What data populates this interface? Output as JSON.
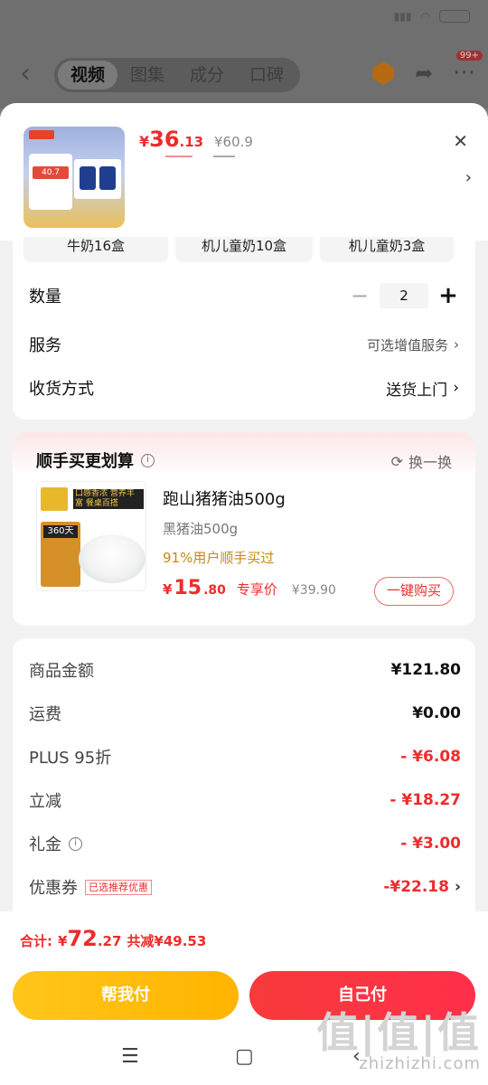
{
  "background": {
    "tabs": [
      "视频",
      "图集",
      "成分",
      "口碑"
    ],
    "active_tab": "视频",
    "cart_badge": "99+"
  },
  "product": {
    "price_symbol": "¥",
    "price_int": "36",
    "price_dec": ".13",
    "original_price": "¥60.9",
    "thumb_price_tag": "40.7"
  },
  "variants": [
    "牛奶16盒",
    "机儿童奶10盒",
    "机儿童奶3盒"
  ],
  "options": {
    "quantity_label": "数量",
    "quantity_value": "2",
    "service_label": "服务",
    "service_value": "可选增值服务",
    "delivery_label": "收货方式",
    "delivery_value": "送货上门"
  },
  "addon": {
    "title": "顺手买更划算",
    "refresh_label": "换一换",
    "name": "跑山猪猪油500g",
    "spec": "黑猪油500g",
    "stat": "91%用户顺手买过",
    "price_symbol": "¥",
    "price_int": "15",
    "price_dec": ".80",
    "price_tag": "专享价",
    "original_price": "¥39.90",
    "buy_label": "一键购买",
    "img_text": "口感香浓 营养丰富 餐桌百搭",
    "img_days": "360天"
  },
  "summary": {
    "rows": [
      {
        "label": "商品金额",
        "value": "¥121.80"
      },
      {
        "label": "运费",
        "value": "¥0.00"
      },
      {
        "label": "PLUS 95折",
        "value": "- ¥6.08"
      },
      {
        "label": "立减",
        "value": "- ¥18.27"
      },
      {
        "label": "礼金",
        "value": "- ¥3.00"
      },
      {
        "label": "优惠券",
        "value": "-¥22.18"
      }
    ],
    "coupon_tag": "已选推荐优惠"
  },
  "total": {
    "label": "合计:",
    "symbol": "¥",
    "int": "72",
    "dec": ".27",
    "saved": "共减¥49.53"
  },
  "buttons": {
    "help_pay": "帮我付",
    "self_pay": "自己付"
  },
  "watermark": {
    "big": "值|值|值",
    "small": "zhizhizhi.com"
  },
  "colors": {
    "accent_red": "#ef2b2b",
    "help_yellow": "#ffc61a",
    "stat_orange": "#c58a10"
  }
}
